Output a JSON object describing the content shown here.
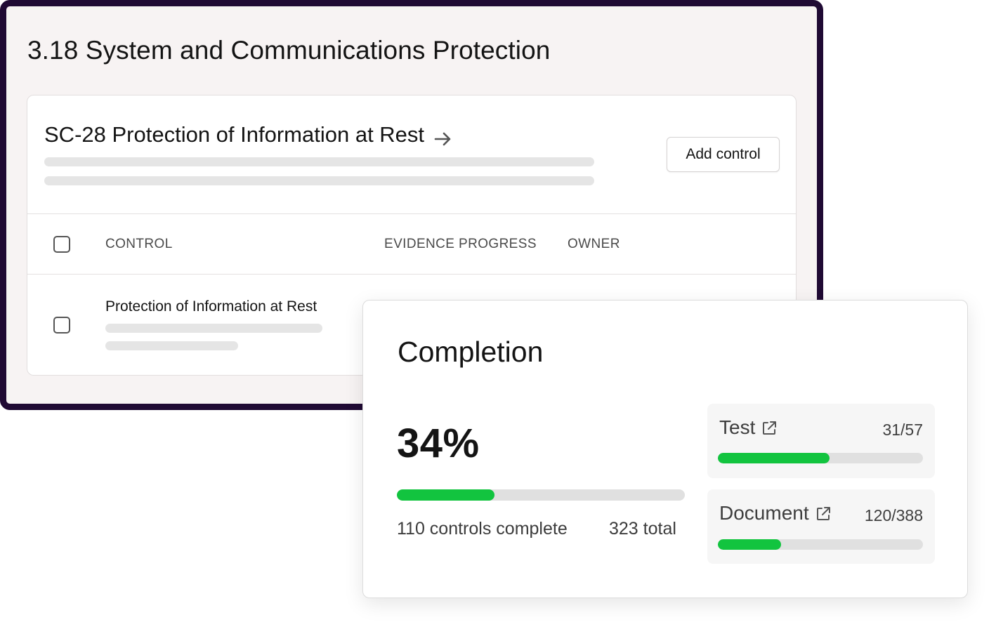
{
  "section": {
    "title": "3.18 System and Communications Protection"
  },
  "control_card": {
    "title": "SC-28 Protection of Information at Rest",
    "arrow_icon": "arrow-right-icon",
    "add_button_label": "Add control",
    "table": {
      "columns": [
        "CONTROL",
        "EVIDENCE PROGRESS",
        "OWNER"
      ],
      "rows": [
        {
          "control": "Protection of Information at Rest"
        }
      ]
    }
  },
  "completion": {
    "title": "Completion",
    "percent_label": "34%",
    "progress": 0.34,
    "complete_label": "110 controls complete",
    "total_label": "323 total",
    "metrics": [
      {
        "name": "Test",
        "count": "31/57",
        "completed": 31,
        "total": 57,
        "icon": "external-link-icon"
      },
      {
        "name": "Document",
        "count": "120/388",
        "completed": 120,
        "total": 388,
        "icon": "external-link-icon"
      }
    ]
  },
  "colors": {
    "window_border": "#200a34",
    "window_bg": "#f7f3f3",
    "progress_fill": "#12c43f",
    "progress_track": "#e0e0e0",
    "skeleton": "#e5e5e5"
  }
}
